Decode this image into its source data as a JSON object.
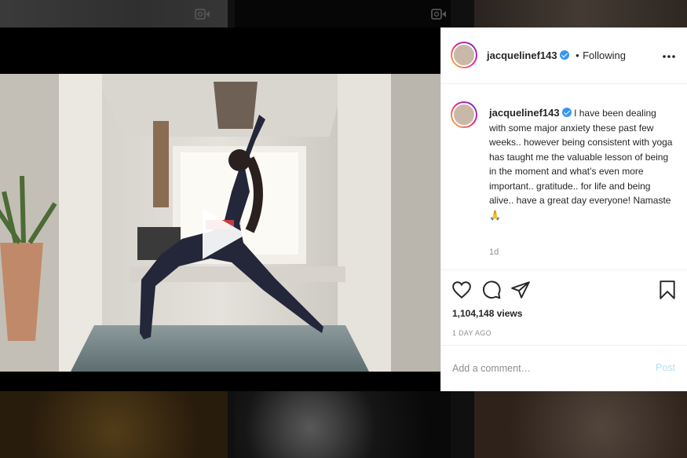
{
  "post": {
    "username": "jacquelinef143",
    "follow_separator": "•",
    "follow_status": "Following",
    "caption": "I have been dealing with some major anxiety these past few weeks.. however being consistent with yoga has taught me the valuable lesson of being in the moment and what’s even more important.. gratitude.. for life and being alive.. have a great day everyone! Namaste 🙏",
    "age": "1d",
    "views": "1,104,148 views",
    "date": "1 DAY AGO"
  },
  "comment": {
    "placeholder": "Add a comment…",
    "post_label": "Post"
  },
  "icons": {
    "more": "more-options-icon",
    "like": "heart-icon",
    "comment": "comment-icon",
    "share": "share-icon",
    "save": "bookmark-icon",
    "play": "play-icon",
    "video": "video-camera-icon"
  },
  "colors": {
    "verified": "#3897f0",
    "post_button_disabled": "#b2dffc",
    "muted_text": "#8e8e8e",
    "text": "#262626"
  }
}
